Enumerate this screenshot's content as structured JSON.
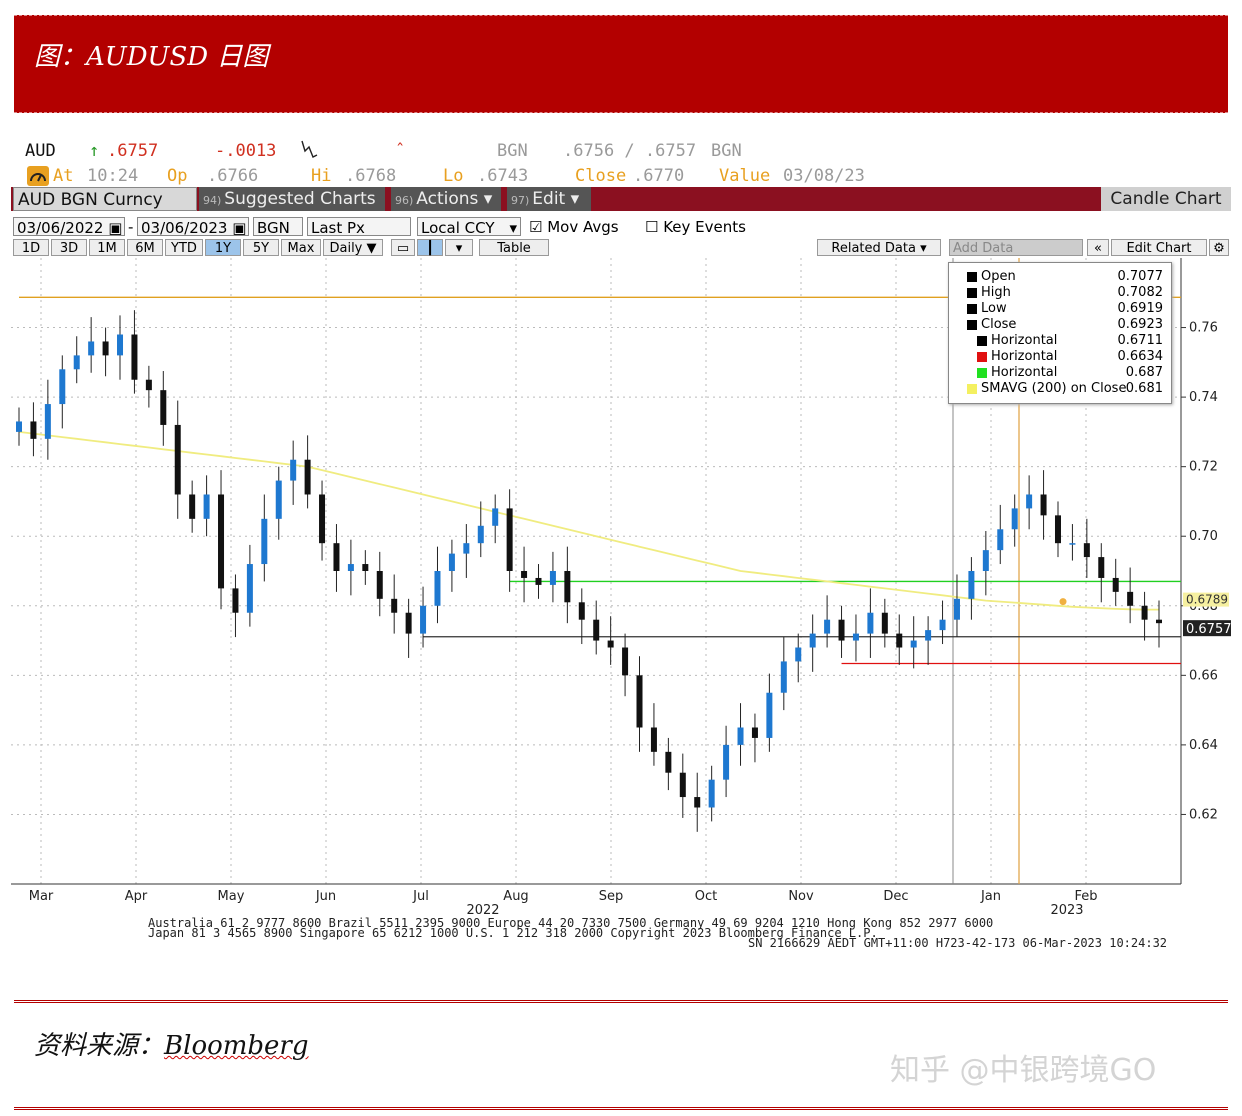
{
  "header": {
    "title": "图：AUDUSD 日图"
  },
  "quote": {
    "ticker": "AUD",
    "arrow": "↑",
    "last": ".6757",
    "change": "-.0013",
    "source1": "BGN",
    "bid_ask": ".6756 / .6757",
    "source2": "BGN",
    "at_label": "At",
    "time": "10:24",
    "op_label": "Op",
    "op": ".6766",
    "hi_label": "Hi",
    "hi": ".6768",
    "lo_label": "Lo",
    "lo": ".6743",
    "close_label": "Close",
    "close": ".6770",
    "value_label": "Value",
    "value_date": "03/08/23"
  },
  "menubar": {
    "security": "AUD BGN Curncy",
    "suggested_num": "94)",
    "suggested": "Suggested Charts",
    "actions_num": "96)",
    "actions": "Actions ▾",
    "edit_num": "97)",
    "edit": "Edit ▾",
    "chart_type": "Candle Chart"
  },
  "controls": {
    "start_date": "03/06/2022",
    "end_date": "03/06/2023",
    "source": "BGN",
    "field": "Last Px",
    "currency": "Local CCY",
    "mov_avgs": "Mov Avgs",
    "key_events": "Key Events"
  },
  "tabs": {
    "periods": [
      "1D",
      "3D",
      "1M",
      "6M",
      "YTD",
      "1Y",
      "5Y",
      "Max"
    ],
    "active": "1Y",
    "frequency": "Daily ▼",
    "table": "Table",
    "related": "Related Data ▾",
    "add_data": "Add Data",
    "edit_chart": "Edit Chart"
  },
  "legend": {
    "rows": [
      {
        "label": "Open",
        "value": "0.7077",
        "color": "#000000"
      },
      {
        "label": "High",
        "value": "0.7082",
        "color": "#000000"
      },
      {
        "label": "Low",
        "value": "0.6919",
        "color": "#000000"
      },
      {
        "label": "Close",
        "value": "0.6923",
        "color": "#000000"
      },
      {
        "label": "Horizontal",
        "value": "0.6711",
        "color": "#000000"
      },
      {
        "label": "Horizontal",
        "value": "0.6634",
        "color": "#e01010"
      },
      {
        "label": "Horizontal",
        "value": "0.687",
        "color": "#20e020"
      },
      {
        "label": "SMAVG (200)  on Close",
        "value": "0.681",
        "color": "#f4f060"
      }
    ]
  },
  "price_tags": {
    "last": "0.6757",
    "sma": "0.6789"
  },
  "footer": {
    "line1": "Australia 61 2 9777 8600 Brazil 5511 2395 9000 Europe 44 20 7330 7500 Germany 49 69 9204 1210 Hong Kong 852 2977 6000",
    "line2": "Japan 81 3 4565 8900          Singapore 65 6212 1000     U.S. 1 212 318 2000          Copyright 2023 Bloomberg Finance L.P.",
    "line3": "SN 2166629 AEDT  GMT+11:00 H723-42-173 06-Mar-2023 10:24:32"
  },
  "source": {
    "label": "资料来源：",
    "name": "Bloomberg"
  },
  "watermark": "知乎 @中银跨境GO",
  "chart_data": {
    "type": "candlestick",
    "x": [
      "Mar",
      "Apr",
      "May",
      "Jun",
      "Jul",
      "Aug",
      "Sep",
      "Oct",
      "Nov",
      "Dec",
      "Jan",
      "Feb"
    ],
    "year_labels": [
      "2022",
      "2023"
    ],
    "ylim": [
      0.6,
      0.78
    ],
    "yticks": [
      0.62,
      0.64,
      0.66,
      0.68,
      0.7,
      0.72,
      0.74,
      0.76
    ],
    "ytick_labels": [
      "0.62",
      "0.64",
      "0.66",
      "0.68",
      "0.70",
      "0.72",
      "0.74",
      "0.76"
    ],
    "series": [
      {
        "name": "Close",
        "values": [
          0.733,
          0.728,
          0.738,
          0.748,
          0.752,
          0.756,
          0.752,
          0.758,
          0.745,
          0.742,
          0.732,
          0.712,
          0.705,
          0.712,
          0.685,
          0.678,
          0.692,
          0.705,
          0.716,
          0.722,
          0.712,
          0.698,
          0.69,
          0.692,
          0.69,
          0.682,
          0.678,
          0.672,
          0.68,
          0.69,
          0.695,
          0.698,
          0.703,
          0.708,
          0.69,
          0.688,
          0.686,
          0.69,
          0.681,
          0.676,
          0.67,
          0.668,
          0.66,
          0.645,
          0.638,
          0.632,
          0.625,
          0.622,
          0.63,
          0.64,
          0.645,
          0.642,
          0.655,
          0.664,
          0.668,
          0.672,
          0.676,
          0.67,
          0.672,
          0.678,
          0.672,
          0.668,
          0.67,
          0.673,
          0.676,
          0.682,
          0.69,
          0.696,
          0.702,
          0.708,
          0.712,
          0.706,
          0.698,
          0.698,
          0.694,
          0.688,
          0.684,
          0.68,
          0.676,
          0.675
        ]
      },
      {
        "name": "SMAVG (200)  on Close",
        "values": [
          0.73,
          0.7295,
          0.729,
          0.7285,
          0.728,
          0.7275,
          0.727,
          0.7265,
          0.726,
          0.7255,
          0.725,
          0.7245,
          0.724,
          0.7235,
          0.723,
          0.7225,
          0.722,
          0.7215,
          0.721,
          0.7205,
          0.72,
          0.719,
          0.718,
          0.717,
          0.716,
          0.715,
          0.714,
          0.713,
          0.712,
          0.711,
          0.71,
          0.709,
          0.708,
          0.707,
          0.706,
          0.705,
          0.704,
          0.703,
          0.702,
          0.701,
          0.7,
          0.699,
          0.698,
          0.697,
          0.696,
          0.695,
          0.694,
          0.693,
          0.692,
          0.691,
          0.69,
          0.6895,
          0.689,
          0.6885,
          0.688,
          0.6875,
          0.687,
          0.6865,
          0.686,
          0.6855,
          0.685,
          0.6845,
          0.684,
          0.6835,
          0.683,
          0.6825,
          0.682,
          0.6815,
          0.6812,
          0.6809,
          0.6806,
          0.6803,
          0.68,
          0.6797,
          0.6795,
          0.6793,
          0.6791,
          0.679,
          0.6789,
          0.6789
        ]
      }
    ],
    "horizontal_lines": [
      {
        "name": "Horizontal",
        "value": 0.6711,
        "color": "#333333",
        "from_index": 28
      },
      {
        "name": "Horizontal",
        "value": 0.6634,
        "color": "#e01010",
        "from_index": 57
      },
      {
        "name": "Horizontal",
        "value": 0.687,
        "color": "#20d020",
        "from_index": 34
      },
      {
        "name": "",
        "value": 0.7687,
        "color": "#e0a020",
        "from_index": 0
      }
    ],
    "grid": true,
    "legend": "top-right",
    "colors": {
      "up": "#1e78d0",
      "down": "#111111",
      "sma": "#f0ec80"
    }
  }
}
